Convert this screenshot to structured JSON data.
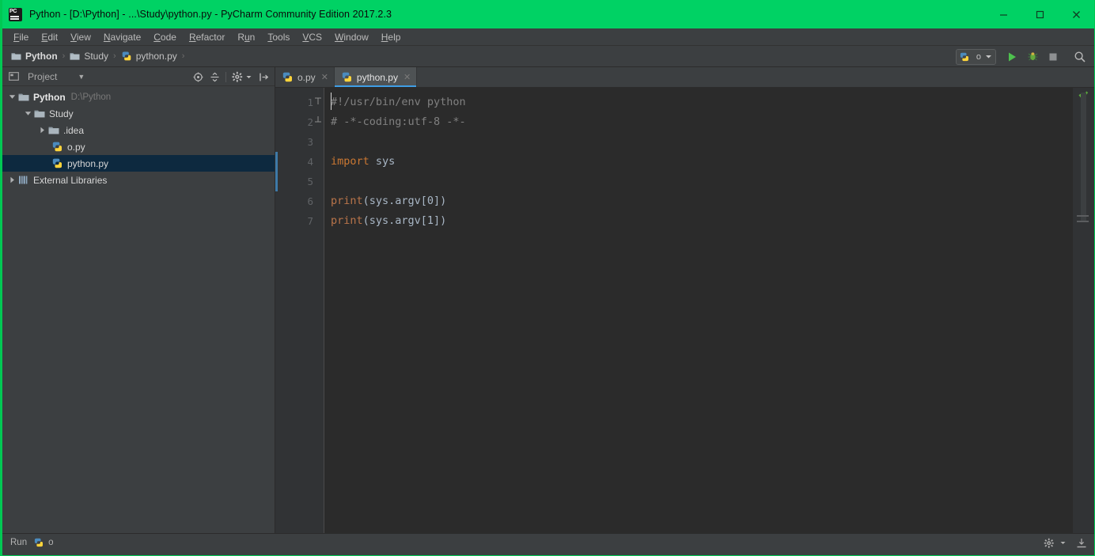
{
  "window": {
    "title": "Python - [D:\\Python] - ...\\Study\\python.py - PyCharm Community Edition 2017.2.3",
    "logo_icon": "pycharm-logo-icon",
    "titlebar_color": "#00d264",
    "minimize_label": "minimize-icon",
    "maximize_label": "maximize-icon",
    "close_label": "close-icon"
  },
  "menubar": {
    "items": [
      {
        "label": "File",
        "mnemonic": "F",
        "rest": "ile"
      },
      {
        "label": "Edit",
        "mnemonic": "E",
        "rest": "dit"
      },
      {
        "label": "View",
        "mnemonic": "V",
        "rest": "iew"
      },
      {
        "label": "Navigate",
        "mnemonic": "N",
        "rest": "avigate"
      },
      {
        "label": "Code",
        "mnemonic": "C",
        "rest": "ode"
      },
      {
        "label": "Refactor",
        "mnemonic": "R",
        "rest": "efactor"
      },
      {
        "label": "Run",
        "mnemonic": "R",
        "rest": "un",
        "pre": "R",
        "mid": "u",
        "post": "n"
      },
      {
        "label": "Tools",
        "mnemonic": "T",
        "rest": "ools"
      },
      {
        "label": "VCS",
        "mnemonic": "V",
        "rest": "CS"
      },
      {
        "label": "Window",
        "mnemonic": "W",
        "rest": "indow"
      },
      {
        "label": "Help",
        "mnemonic": "H",
        "rest": "elp"
      }
    ]
  },
  "navbar": {
    "breadcrumbs": [
      {
        "label": "Python",
        "icon": "folder-icon",
        "bold": true
      },
      {
        "label": "Study",
        "icon": "folder-icon",
        "bold": false
      },
      {
        "label": "python.py",
        "icon": "python-file-icon",
        "bold": false
      }
    ],
    "separator": "›",
    "run_config": {
      "name": "o",
      "icon": "python-config-icon",
      "dropdown_icon": "chevron-down-icon"
    },
    "buttons": [
      {
        "name": "run-button",
        "icon": "run-play-icon",
        "color": "#4caf50"
      },
      {
        "name": "debug-button",
        "icon": "debug-bug-icon",
        "color": "#5a9e48"
      },
      {
        "name": "stop-button",
        "icon": "stop-square-icon",
        "color": "#8c8c8c"
      },
      {
        "name": "search-everywhere-button",
        "icon": "search-icon",
        "color": "#b0b0b0"
      }
    ]
  },
  "project_panel": {
    "title": "Project",
    "window_icon": "project-window-icon",
    "dropdown_icon": "chevron-down-icon",
    "toolbar": [
      {
        "name": "scroll-from-source-button",
        "icon": "target-icon"
      },
      {
        "name": "collapse-all-button",
        "icon": "collapse-all-icon"
      },
      {
        "name": "settings-button",
        "icon": "gear-icon"
      },
      {
        "name": "hide-button",
        "icon": "hide-panel-icon"
      }
    ],
    "tree": [
      {
        "label": "Python",
        "sublabel": "D:\\Python",
        "icon": "folder-icon",
        "twisty": "expanded",
        "indent": 0,
        "bold": true,
        "selected": false
      },
      {
        "label": "Study",
        "sublabel": "",
        "icon": "folder-icon",
        "twisty": "expanded",
        "indent": 1,
        "bold": false,
        "selected": false
      },
      {
        "label": ".idea",
        "sublabel": "",
        "icon": "folder-icon",
        "twisty": "collapsed",
        "indent": 2,
        "bold": false,
        "selected": false
      },
      {
        "label": "o.py",
        "sublabel": "",
        "icon": "python-file-icon",
        "twisty": "none",
        "indent": 3,
        "bold": false,
        "selected": false
      },
      {
        "label": "python.py",
        "sublabel": "",
        "icon": "python-file-icon",
        "twisty": "none",
        "indent": 3,
        "bold": false,
        "selected": true
      },
      {
        "label": "External Libraries",
        "sublabel": "",
        "icon": "library-icon",
        "twisty": "collapsed",
        "indent": 0,
        "bold": false,
        "selected": false
      }
    ]
  },
  "editor": {
    "tabs": [
      {
        "label": "o.py",
        "icon": "python-file-icon",
        "active": false,
        "close_icon": "close-icon"
      },
      {
        "label": "python.py",
        "icon": "python-file-icon",
        "active": true,
        "close_icon": "close-icon"
      }
    ],
    "line_numbers": [
      "1",
      "2",
      "3",
      "4",
      "5",
      "6",
      "7"
    ],
    "lines": [
      {
        "n": "1",
        "tokens": [
          {
            "t": "#!/usr/bin/env python",
            "c": "c-comment"
          }
        ]
      },
      {
        "n": "2",
        "tokens": [
          {
            "t": "# -*-coding:utf-8 -*-",
            "c": "c-comment"
          }
        ]
      },
      {
        "n": "3",
        "tokens": [
          {
            "t": "",
            "c": "c-plain"
          }
        ]
      },
      {
        "n": "4",
        "tokens": [
          {
            "t": "import",
            "c": "c-kw"
          },
          {
            "t": " sys",
            "c": "c-plain"
          }
        ]
      },
      {
        "n": "5",
        "tokens": [
          {
            "t": "",
            "c": "c-plain"
          }
        ]
      },
      {
        "n": "6",
        "tokens": [
          {
            "t": "print",
            "c": "c-fn"
          },
          {
            "t": "(sys.argv[0])",
            "c": "c-plain"
          }
        ]
      },
      {
        "n": "7",
        "tokens": [
          {
            "t": "print",
            "c": "c-fn"
          },
          {
            "t": "(sys.argv[1])",
            "c": "c-plain"
          }
        ]
      }
    ],
    "inspection_status_icon": "green-check-icon",
    "inspection_status_color": "#5a9e48",
    "caret_line": 1,
    "fold_markers": [
      "1",
      "2"
    ]
  },
  "statusbar": {
    "left": [
      {
        "label": "Run",
        "icon": ""
      },
      {
        "label": "o",
        "icon": "python-config-icon"
      }
    ],
    "right": [
      {
        "name": "settings-button",
        "icon": "gear-icon"
      },
      {
        "name": "layout-button",
        "icon": "layout-icon"
      }
    ]
  }
}
